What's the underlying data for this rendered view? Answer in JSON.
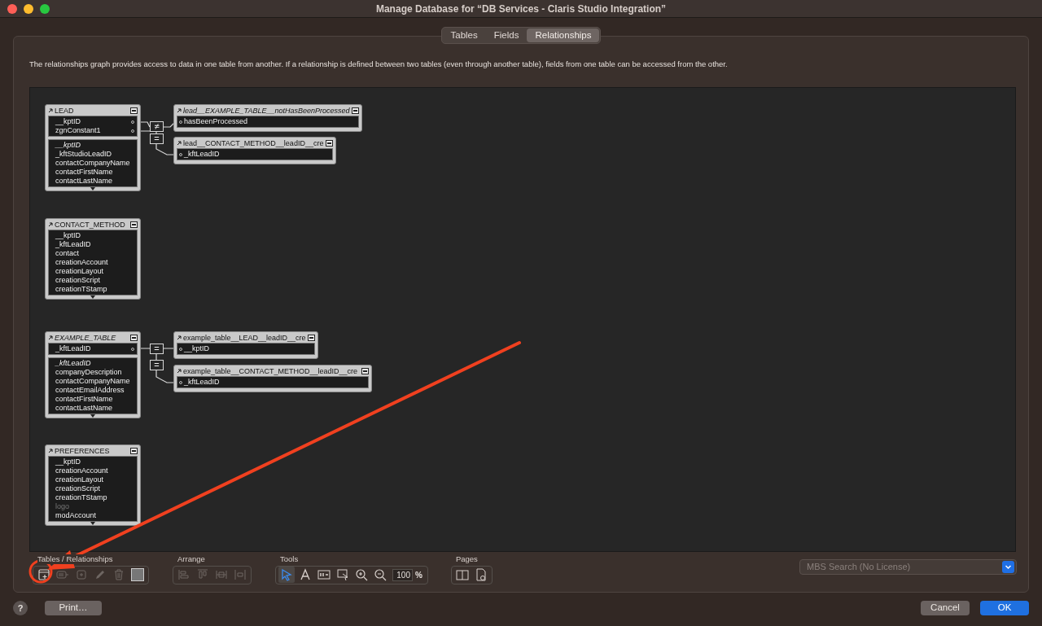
{
  "window": {
    "title": "Manage Database for “DB Services - Claris Studio Integration”"
  },
  "tabs": [
    {
      "label": "Tables",
      "selected": false
    },
    {
      "label": "Fields",
      "selected": false
    },
    {
      "label": "Relationships",
      "selected": true
    }
  ],
  "description": "The relationships graph provides access to data in one table from another. If a relationship is defined between two tables (even through another table), fields from one table can be accessed from the other.",
  "graph": {
    "tables": [
      {
        "kind": "base",
        "name": "LEAD",
        "italic": false,
        "key_fields": [
          "__kptID",
          "zgnConstant1"
        ],
        "fields": [
          {
            "label": "__kptID",
            "kind": "italic"
          },
          {
            "label": "_kftStudioLeadID",
            "kind": "normal"
          },
          {
            "label": "contactCompanyName",
            "kind": "normal"
          },
          {
            "label": "contactFirstName",
            "kind": "normal"
          },
          {
            "label": "contactLastName",
            "kind": "normal"
          }
        ]
      },
      {
        "kind": "related",
        "name": "lead__EXAMPLE_TABLE__notHasBeenProcessed",
        "italic": true,
        "key_fields": [
          "hasBeenProcessed"
        ]
      },
      {
        "kind": "related",
        "name": "lead__CONTACT_METHOD__leadID__cre",
        "italic": false,
        "key_fields": [
          "_kftLeadID"
        ]
      },
      {
        "kind": "base",
        "name": "CONTACT_METHOD",
        "italic": false,
        "fields": [
          {
            "label": "__kptID",
            "kind": "normal"
          },
          {
            "label": "_kftLeadID",
            "kind": "normal"
          },
          {
            "label": "contact",
            "kind": "normal"
          },
          {
            "label": "creationAccount",
            "kind": "normal"
          },
          {
            "label": "creationLayout",
            "kind": "normal"
          },
          {
            "label": "creationScript",
            "kind": "normal"
          },
          {
            "label": "creationTStamp",
            "kind": "normal"
          }
        ]
      },
      {
        "kind": "base",
        "name": "EXAMPLE_TABLE",
        "italic": true,
        "key_fields": [
          "_kftLeadID"
        ],
        "fields": [
          {
            "label": "_kftLeadID",
            "kind": "italic"
          },
          {
            "label": "companyDescription",
            "kind": "normal"
          },
          {
            "label": "contactCompanyName",
            "kind": "normal"
          },
          {
            "label": "contactEmailAddress",
            "kind": "normal"
          },
          {
            "label": "contactFirstName",
            "kind": "normal"
          },
          {
            "label": "contactLastName",
            "kind": "normal"
          }
        ]
      },
      {
        "kind": "related",
        "name": "example_table__LEAD__leadID__cre",
        "italic": false,
        "key_fields": [
          "__kptID"
        ]
      },
      {
        "kind": "related",
        "name": "example_table__CONTACT_METHOD__leadID__cre",
        "italic": false,
        "key_fields": [
          "_kftLeadID"
        ]
      },
      {
        "kind": "base",
        "name": "PREFERENCES",
        "italic": false,
        "fields": [
          {
            "label": "__kptID",
            "kind": "normal"
          },
          {
            "label": "creationAccount",
            "kind": "normal"
          },
          {
            "label": "creationLayout",
            "kind": "normal"
          },
          {
            "label": "creationScript",
            "kind": "normal"
          },
          {
            "label": "creationTStamp",
            "kind": "normal"
          },
          {
            "label": "logo",
            "kind": "dimmed"
          },
          {
            "label": "modAccount",
            "kind": "normal"
          }
        ]
      }
    ],
    "relationships": [
      {
        "operator": "≠"
      },
      {
        "operator": "="
      },
      {
        "operator": "="
      },
      {
        "operator": "="
      }
    ]
  },
  "toolbar": {
    "groups": [
      {
        "label": "Tables / Relationships",
        "tools": [
          {
            "kind": "add_table",
            "disabled": false
          },
          {
            "kind": "add_note",
            "disabled": true
          },
          {
            "kind": "duplicate",
            "disabled": true
          },
          {
            "kind": "edit",
            "disabled": true
          },
          {
            "kind": "delete",
            "disabled": true
          },
          {
            "kind": "color"
          }
        ]
      },
      {
        "label": "Arrange",
        "tools": [
          {
            "kind": "align_left",
            "disabled": true
          },
          {
            "kind": "align_top",
            "disabled": true
          },
          {
            "kind": "distribute_h",
            "disabled": true
          },
          {
            "kind": "resize",
            "disabled": true
          }
        ]
      },
      {
        "label": "Tools",
        "tools": [
          {
            "kind": "pointer",
            "selected": true
          },
          {
            "kind": "text",
            "selected": false
          },
          {
            "kind": "field",
            "selected": false
          },
          {
            "kind": "select_related",
            "selected": false
          },
          {
            "kind": "zoom_in",
            "selected": false
          },
          {
            "kind": "zoom_out",
            "selected": false
          }
        ],
        "zoom": "100",
        "zoom_unit": "%"
      },
      {
        "label": "Pages",
        "tools": [
          {
            "kind": "page_breaks",
            "disabled": false
          },
          {
            "kind": "page_setup",
            "disabled": false
          }
        ]
      }
    ],
    "search_popup": "MBS Search (No License)"
  },
  "buttons": {
    "help": "?",
    "print": "Print…",
    "cancel": "Cancel",
    "ok": "OK"
  }
}
